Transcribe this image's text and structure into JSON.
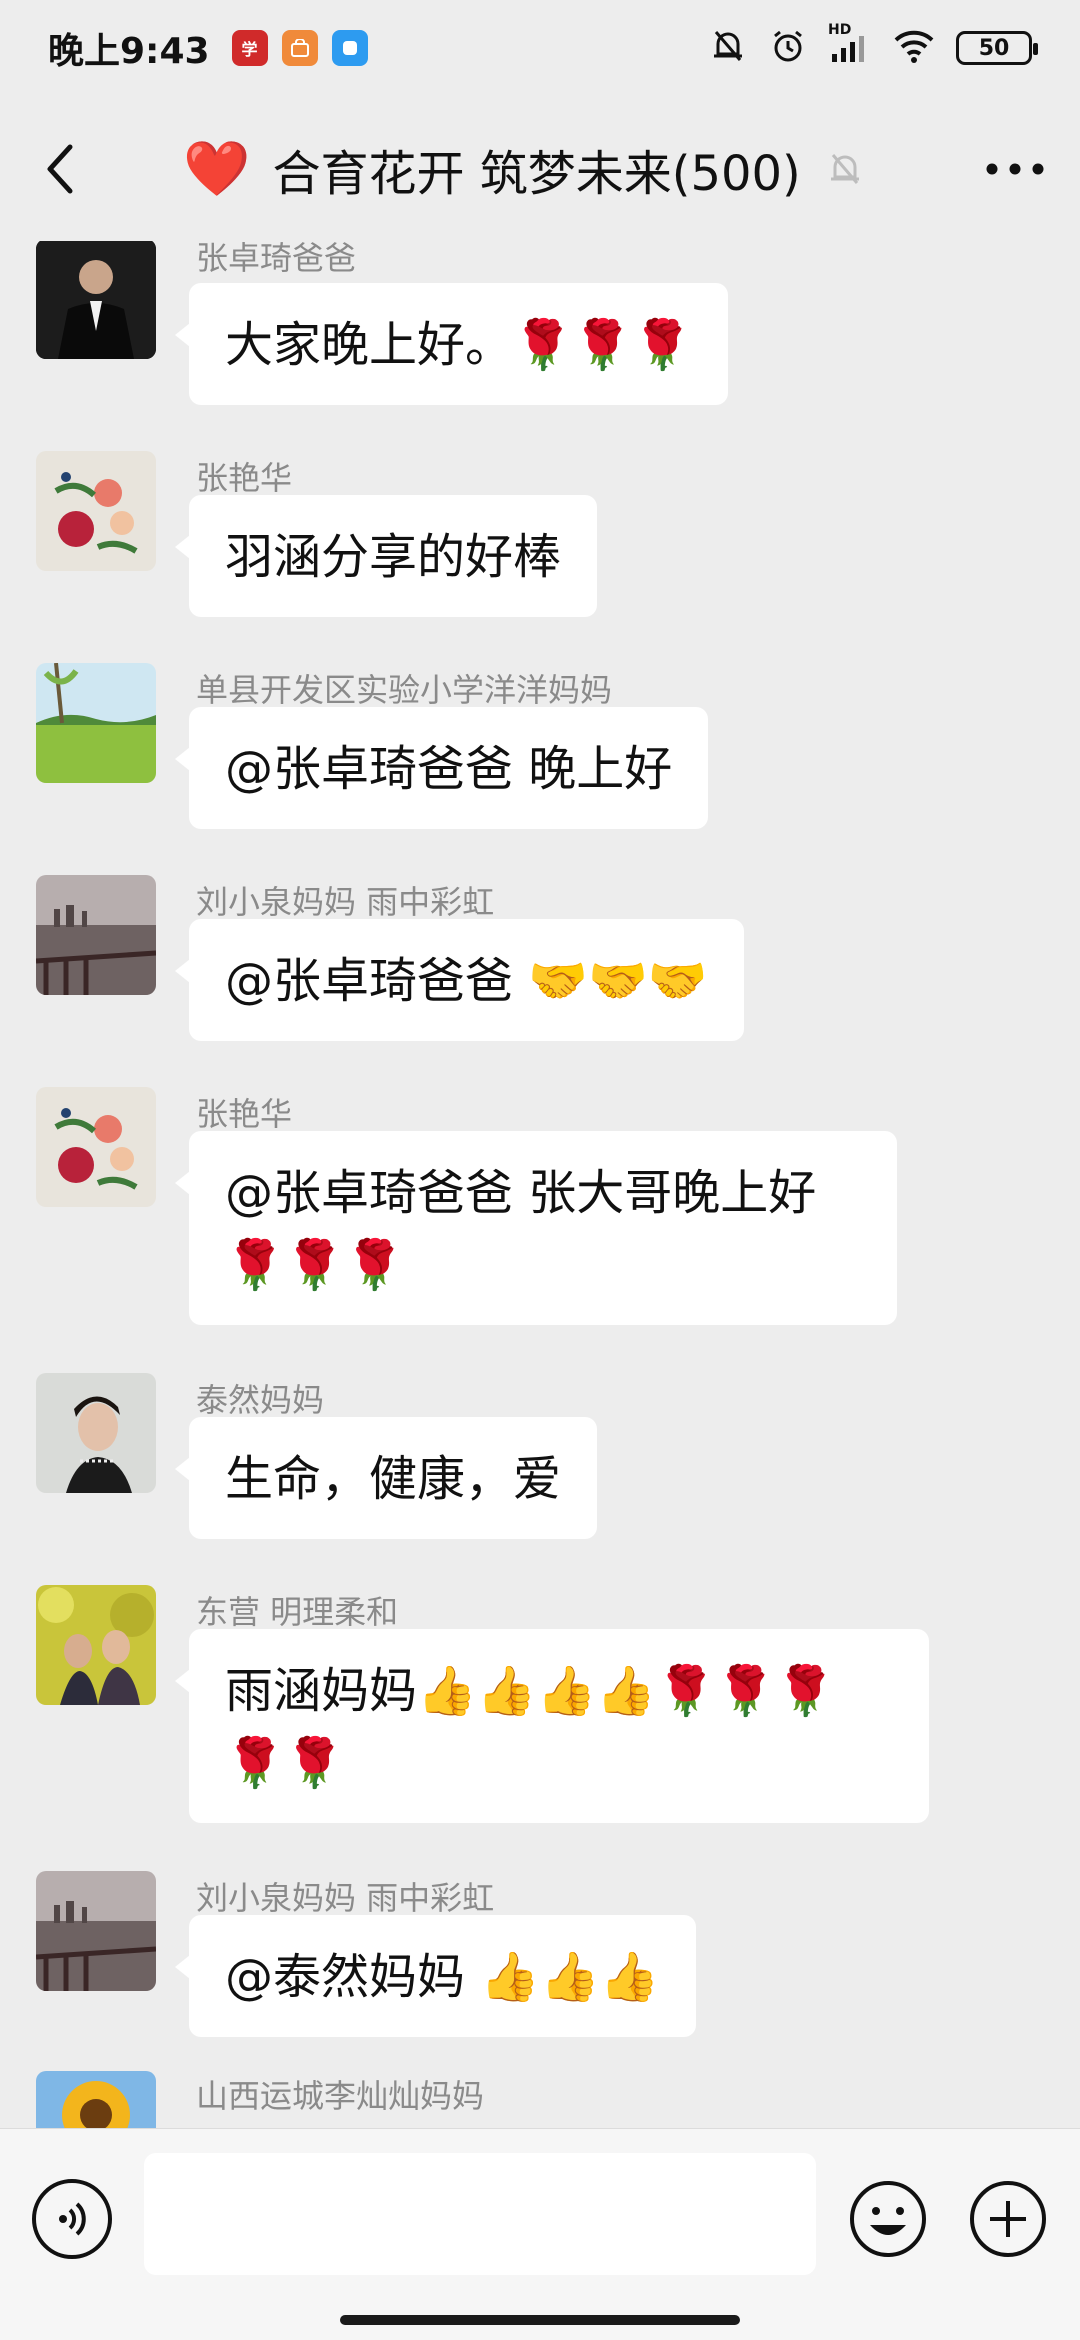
{
  "status_bar": {
    "time": "晚上9:43",
    "battery": "50",
    "network_badge": "HD",
    "apps": [
      {
        "name": "news-app-icon",
        "color": "#d02a2a",
        "glyph": "学"
      },
      {
        "name": "shop-app-icon",
        "color": "#f08a3a",
        "glyph": "▢"
      },
      {
        "name": "chat-app-icon",
        "color": "#2d9bf0",
        "glyph": "▢"
      }
    ]
  },
  "header": {
    "title_emoji": "❤️",
    "title": "合育花开 筑梦未来(500)"
  },
  "messages": [
    {
      "sender": "张卓琦爸爸",
      "text": "大家晚上好。🌹🌹🌹",
      "avatar": "person-in-suit"
    },
    {
      "sender": "张艳华",
      "text": "羽涵分享的好棒",
      "avatar": "peony-painting"
    },
    {
      "sender": "单县开发区实验小学洋洋妈妈",
      "text": "@张卓琦爸爸  晚上好",
      "avatar": "green-field"
    },
    {
      "sender": "刘小泉妈妈  雨中彩虹",
      "text": "@张卓琦爸爸 🤝🤝🤝",
      "avatar": "lake-city"
    },
    {
      "sender": "张艳华",
      "text": "@张卓琦爸爸  张大哥晚上好🌹🌹🌹",
      "avatar": "peony-painting"
    },
    {
      "sender": "泰然妈妈",
      "text": "生命，健康，爱",
      "avatar": "woman-portrait"
    },
    {
      "sender": "东营  明理柔和",
      "text": "雨涵妈妈👍👍👍👍🌹🌹🌹🌹🌹",
      "avatar": "two-people-yellow"
    },
    {
      "sender": "刘小泉妈妈  雨中彩虹",
      "text": "@泰然妈妈 👍👍👍",
      "avatar": "lake-city"
    },
    {
      "sender": "山西运城李灿灿妈妈",
      "text": "",
      "avatar": "sunflower"
    }
  ],
  "input": {
    "placeholder": ""
  },
  "colors": {
    "background": "#ededed",
    "bubble": "#ffffff",
    "sender_text": "#8a8a8a"
  }
}
